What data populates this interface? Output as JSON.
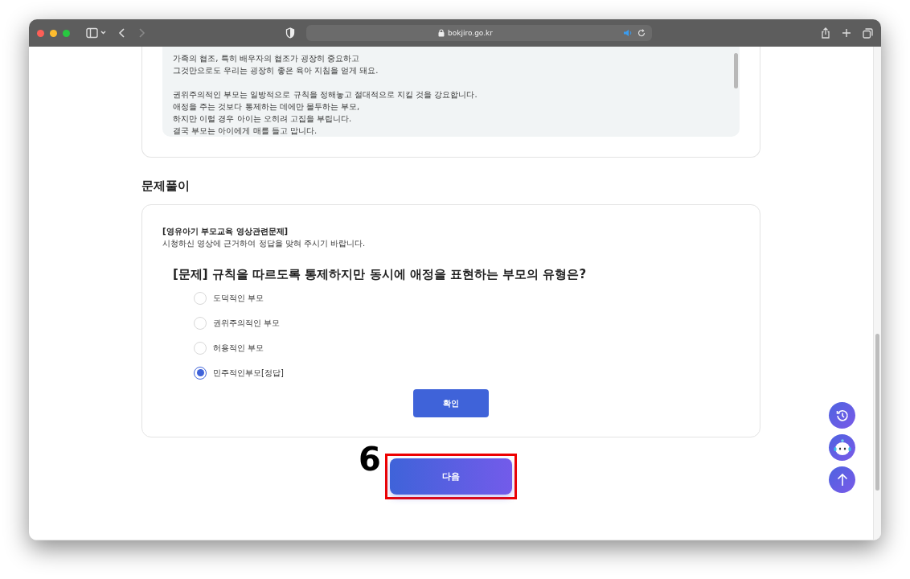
{
  "browser": {
    "url": "bokjiro.go.kr"
  },
  "transcript": {
    "paragraphs": [
      [
        "가족의 협조, 특히 배우자의 협조가 굉장히 중요하고",
        "그것만으로도 우리는 굉장히 좋은 육아 지침을 얻게 돼요."
      ],
      [
        "권위주의적인 부모는 일방적으로 규칙을 정해놓고 절대적으로 지킬 것을 강요합니다.",
        "애정을 주는 것보다 통제하는 데에만 몰두하는 부모,",
        "하지만 이럴 경우 아이는 오히려 고집을 부립니다.",
        "결국 부모는 아이에게 매를 들고 맙니다."
      ]
    ]
  },
  "quiz": {
    "heading": "문제풀이",
    "label": "[영유아기 부모교육 영상관련문제]",
    "instruction": "시청하신 영상에 근거하여 정답을 맞혀 주시기 바랍니다.",
    "question": "[문제] 규칙을 따르도록 통제하지만 동시에 애정을 표현하는 부모의 유형은?",
    "options": [
      {
        "label": "도덕적인 부모",
        "selected": false
      },
      {
        "label": "권위주의적인 부모",
        "selected": false
      },
      {
        "label": "허용적인 부모",
        "selected": false
      },
      {
        "label": "민주적인부모[정답]",
        "selected": true
      }
    ],
    "confirm_button": "확인"
  },
  "next_button": "다음",
  "annotation": {
    "number": "6"
  }
}
